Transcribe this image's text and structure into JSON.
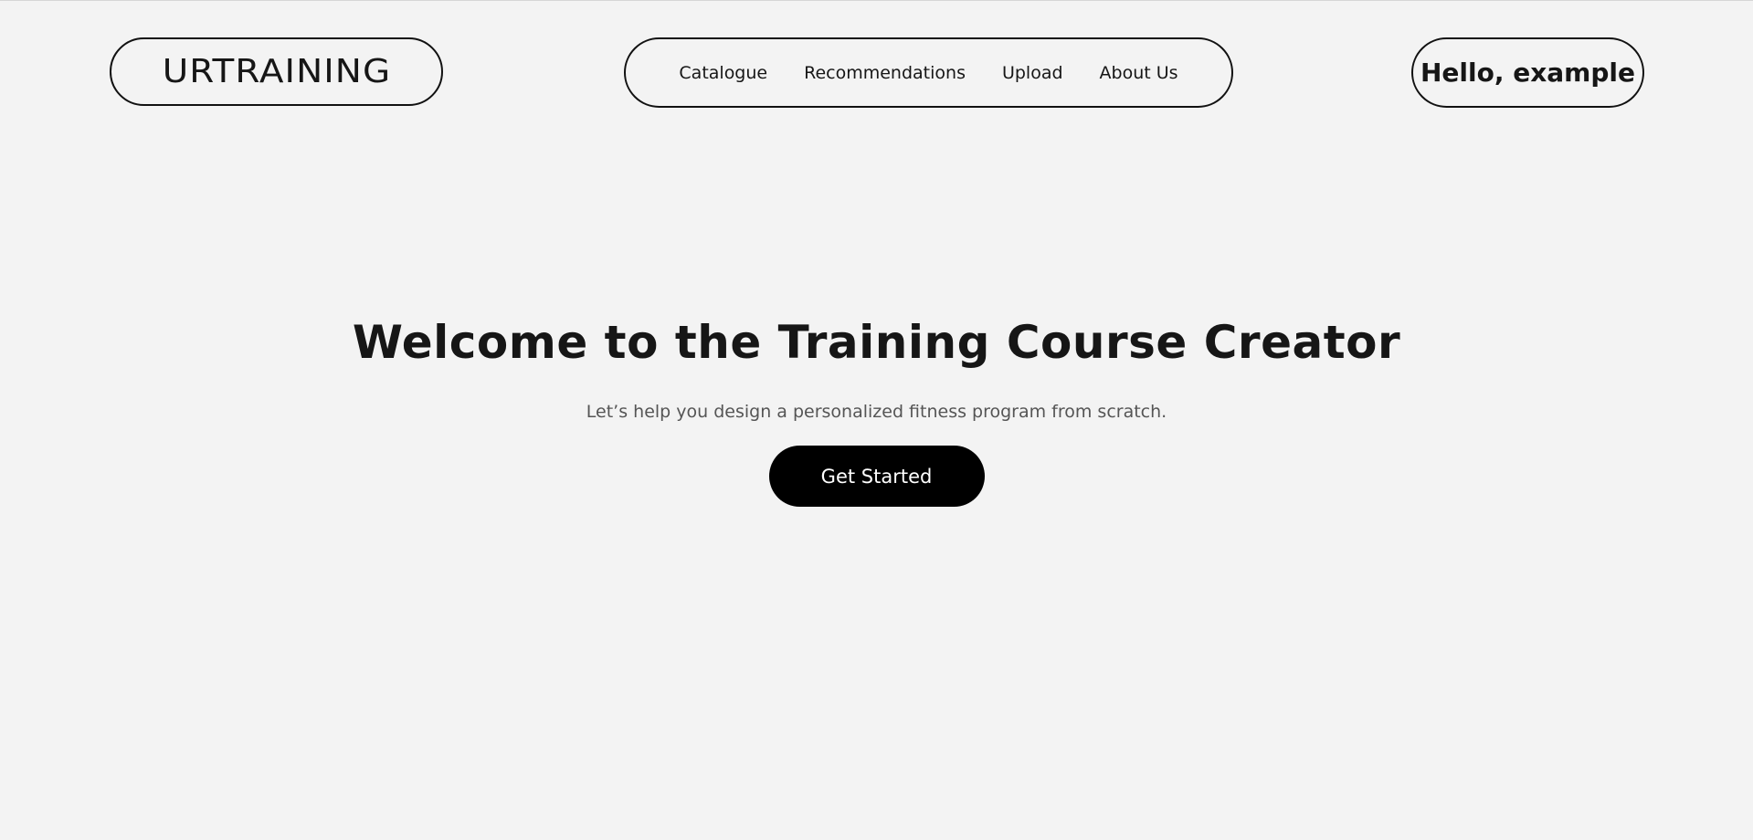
{
  "header": {
    "logo_text": "URTRAINING",
    "nav": [
      {
        "label": "Catalogue"
      },
      {
        "label": "Recommendations"
      },
      {
        "label": "Upload"
      },
      {
        "label": "About Us"
      }
    ],
    "user_greeting": "Hello, example"
  },
  "hero": {
    "title": "Welcome to the Training Course Creator",
    "subtitle": "Let’s help you design a personalized fitness program from scratch.",
    "cta_label": "Get Started"
  }
}
